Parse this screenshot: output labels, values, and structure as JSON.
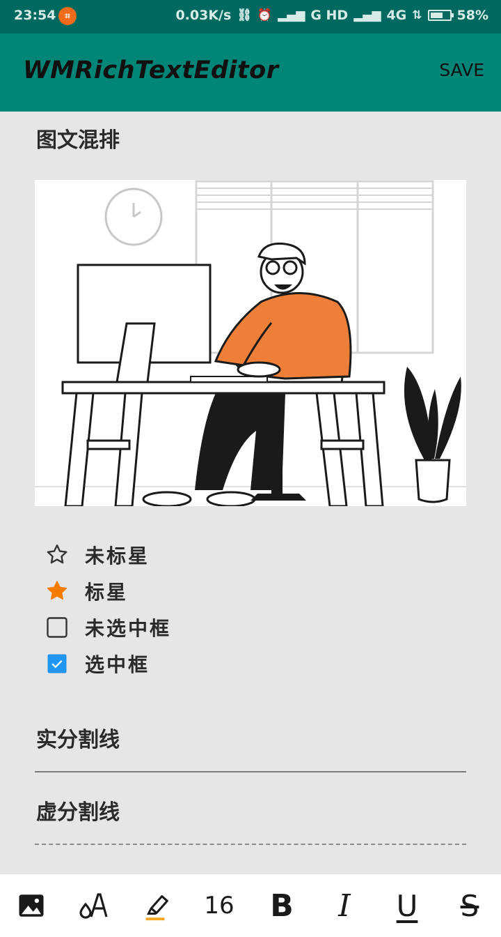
{
  "status_bar": {
    "time": "23:54",
    "network_speed": "0.03K/s",
    "signal_text_1": "G HD",
    "signal_text_2": "4G",
    "battery": "58%"
  },
  "app_bar": {
    "title": "WMRichTextEditor",
    "save_label": "SAVE"
  },
  "content": {
    "heading_image": "图文混排",
    "checklist": [
      {
        "label": "未标星",
        "icon": "star-outline-icon"
      },
      {
        "label": "标星",
        "icon": "star-filled-icon"
      },
      {
        "label": "未选中框",
        "icon": "checkbox-unchecked-icon"
      },
      {
        "label": "选中框",
        "icon": "checkbox-checked-icon"
      }
    ],
    "heading_solid": "实分割线",
    "heading_dashed": "虚分割线"
  },
  "toolbar": {
    "font_size": "16",
    "bold_label": "B",
    "italic_label": "I",
    "underline_label": "U",
    "strike_label": "S"
  },
  "colors": {
    "status_bar": "#00695f",
    "app_bar": "#008577",
    "star": "#f57c00",
    "checkbox_checked": "#2196f3",
    "highlight_underline": "#f5a623"
  }
}
